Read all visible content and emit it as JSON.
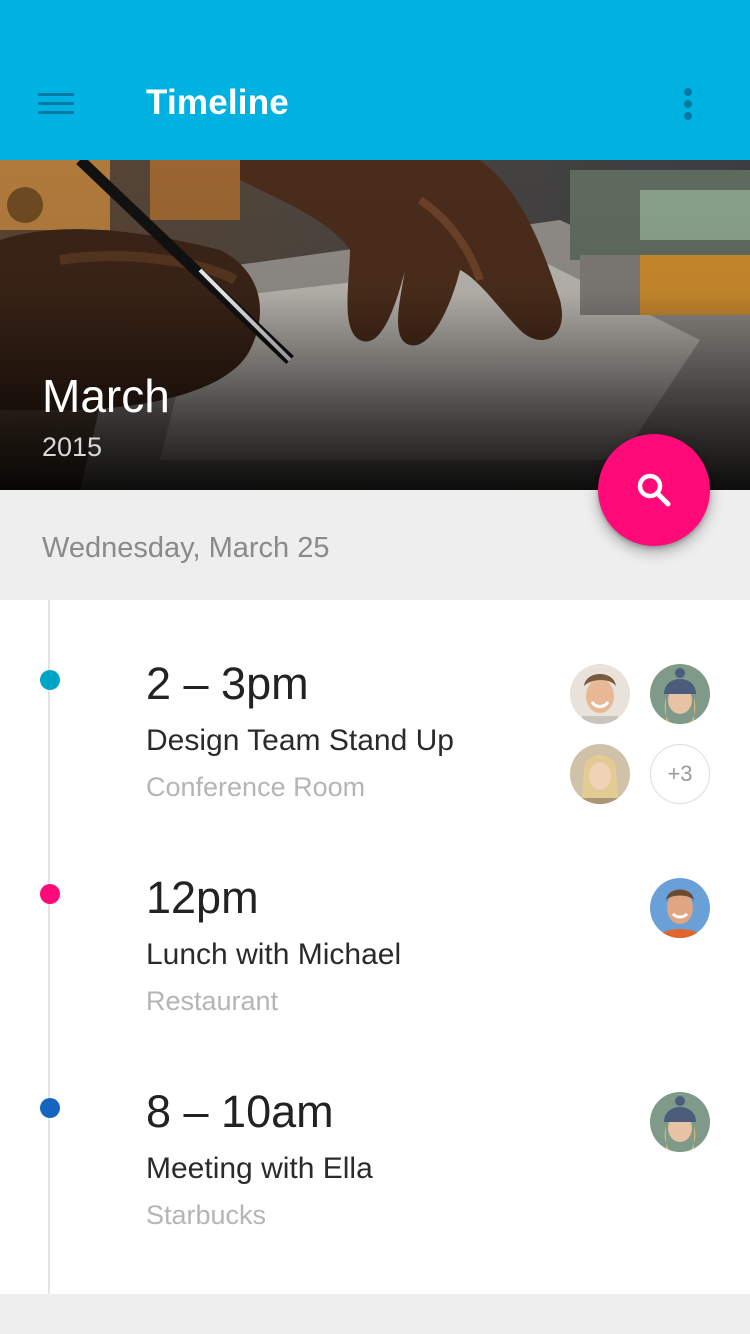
{
  "app_bar": {
    "title": "Timeline",
    "background_color": "#00b2e2",
    "menu_icon": "hamburger-menu-icon",
    "more_icon": "vertical-dots-icon"
  },
  "hero": {
    "month": "March",
    "year": "2015"
  },
  "fab": {
    "icon": "search-icon",
    "color": "#ff0a78"
  },
  "date_header": "Wednesday, March 25",
  "events": [
    {
      "time": "2 – 3pm",
      "title": "Design Team Stand Up",
      "location": "Conference Room",
      "dot_color": "#00a5c6",
      "attendees": [
        "avatar-man-smiling",
        "avatar-woman-beanie",
        "avatar-woman-blonde"
      ],
      "more_attendees": "+3"
    },
    {
      "time": "12pm",
      "title": "Lunch with Michael",
      "location": "Restaurant",
      "dot_color": "#ff0a78",
      "attendees": [
        "avatar-michael"
      ]
    },
    {
      "time": "8 – 10am",
      "title": "Meeting with Ella",
      "location": "Starbucks",
      "dot_color": "#1565c0",
      "attendees": [
        "avatar-ella"
      ]
    }
  ]
}
